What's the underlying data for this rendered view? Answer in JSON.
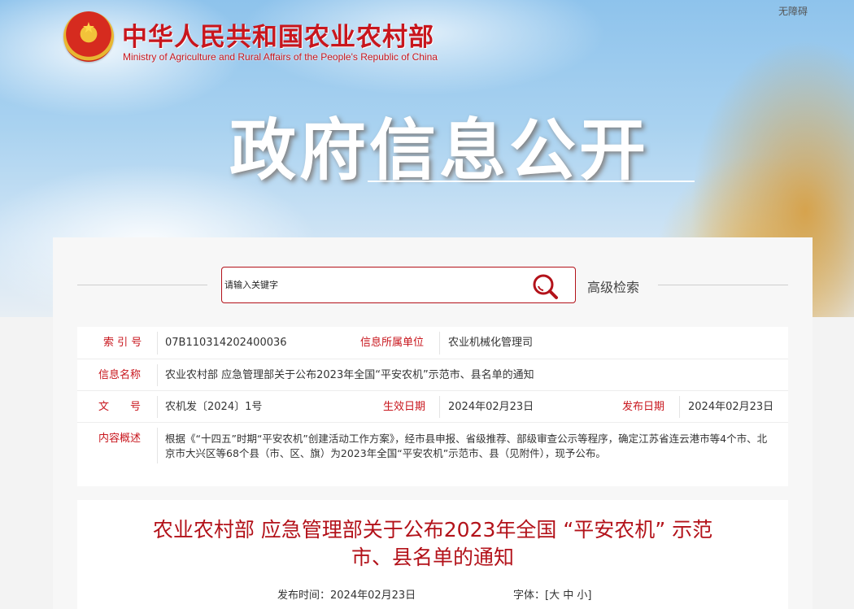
{
  "header": {
    "ministry_cn": "中华人民共和国农业农村部",
    "ministry_en": "Ministry of Agriculture and Rural Affairs of the People's Republic of China",
    "accessibility": "无障碍",
    "banner_title": "政府信息公开"
  },
  "search": {
    "placeholder": "请输入关键字",
    "advanced_label": "高级检索"
  },
  "info": {
    "index_label": "索 引 号",
    "index_value": "07B110314202400036",
    "unit_label": "信息所属单位",
    "unit_value": "农业机械化管理司",
    "name_label": "信息名称",
    "name_value": "农业农村部 应急管理部关于公布2023年全国“平安农机”示范市、县名单的通知",
    "doc_label": "文　　号",
    "doc_value": "农机发〔2024〕1号",
    "effective_label": "生效日期",
    "effective_value": "2024年02月23日",
    "publish_label": "发布日期",
    "publish_value": "2024年02月23日",
    "summary_label": "内容概述",
    "summary_value": "根据《“十四五”时期“平安农机”创建活动工作方案》，经市县申报、省级推荐、部级审查公示等程序，确定江苏省连云港市等4个市、北京市大兴区等68个县（市、区、旗）为2023年全国“平安农机”示范市、县（见附件），现予公布。"
  },
  "article": {
    "title_line1": "农业农村部 应急管理部关于公布2023年全国 “平安农机” 示范",
    "title_line2": "市、县名单的通知",
    "date_label": "发布时间：",
    "date_value": "2024年02月23日",
    "font_label": "字体：",
    "font_open": "[",
    "font_large": "大",
    "font_medium": "中",
    "font_small": "小",
    "font_close": "]"
  },
  "colors": {
    "brand_red": "#c8161d",
    "title_red": "#b3121a"
  }
}
